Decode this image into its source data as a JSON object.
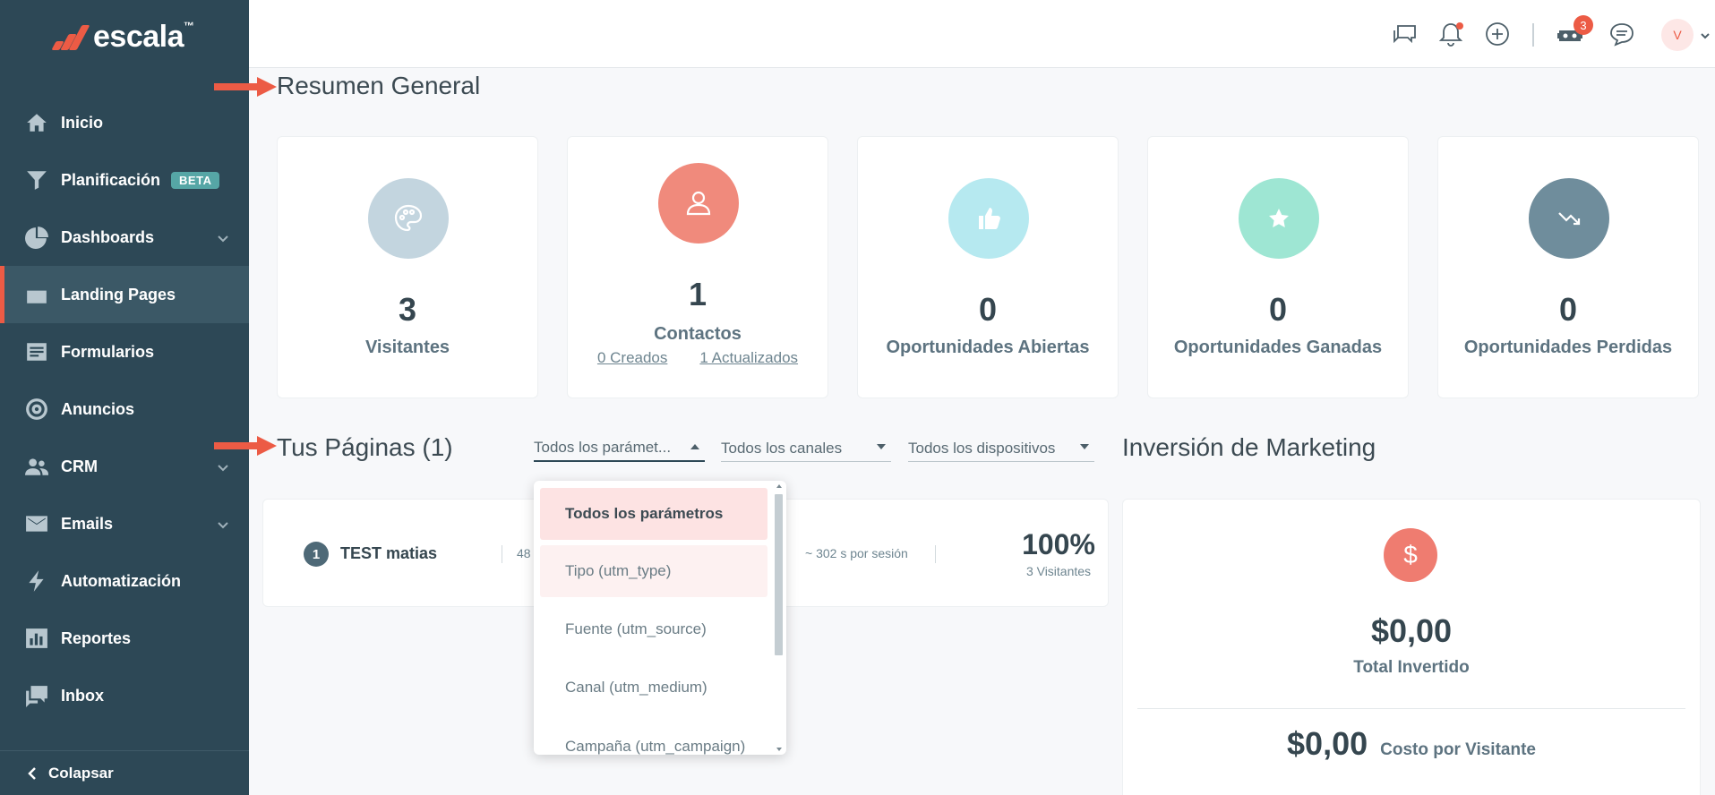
{
  "brand": {
    "name": "escala",
    "tm": "™"
  },
  "sidebar": {
    "items": [
      {
        "label": "Inicio"
      },
      {
        "label": "Planificación",
        "badge": "BETA"
      },
      {
        "label": "Dashboards"
      },
      {
        "label": "Landing Pages"
      },
      {
        "label": "Formularios"
      },
      {
        "label": "Anuncios"
      },
      {
        "label": "CRM"
      },
      {
        "label": "Emails"
      },
      {
        "label": "Automatización"
      },
      {
        "label": "Reportes"
      },
      {
        "label": "Inbox"
      }
    ],
    "collapse_label": "Colapsar"
  },
  "topbar": {
    "robot_badge": "3",
    "avatar_initial": "V"
  },
  "overview": {
    "title": "Resumen General",
    "cards": [
      {
        "value": "3",
        "label": "Visitantes",
        "color": "#c3d5df"
      },
      {
        "value": "1",
        "label": "Contactos",
        "color": "#f08a7c",
        "link_created": "0 Creados",
        "link_updated": "1 Actualizados"
      },
      {
        "value": "0",
        "label": "Oportunidades Abiertas",
        "color": "#b6e9f0"
      },
      {
        "value": "0",
        "label": "Oportunidades Ganadas",
        "color": "#9ee6d3"
      },
      {
        "value": "0",
        "label": "Oportunidades Perdidas",
        "color": "#6f8d9c"
      }
    ]
  },
  "pages": {
    "title": "Tus Páginas (1)",
    "filters": [
      {
        "value": "Todos los parámet..."
      },
      {
        "value": "Todos los canales"
      },
      {
        "value": "Todos los dispositivos"
      }
    ],
    "rows": [
      {
        "index": "1",
        "name": "TEST matias",
        "partial_value": "48",
        "session": "~ 302 s por sesión",
        "pct": "100%",
        "visitors": "3 Visitantes"
      }
    ],
    "dropdown_options": [
      "Todos los parámetros",
      "Tipo (utm_type)",
      "Fuente (utm_source)",
      "Canal (utm_medium)",
      "Campaña (utm_campaign)"
    ]
  },
  "investment": {
    "title": "Inversión de Marketing",
    "currency_symbol": "$",
    "total_value": "$0,00",
    "total_label": "Total Invertido",
    "cpv_value": "$0,00",
    "cpv_label": "Costo por Visitante"
  },
  "colors": {
    "accent": "#ec5b45",
    "sidebar": "#2d4856"
  }
}
